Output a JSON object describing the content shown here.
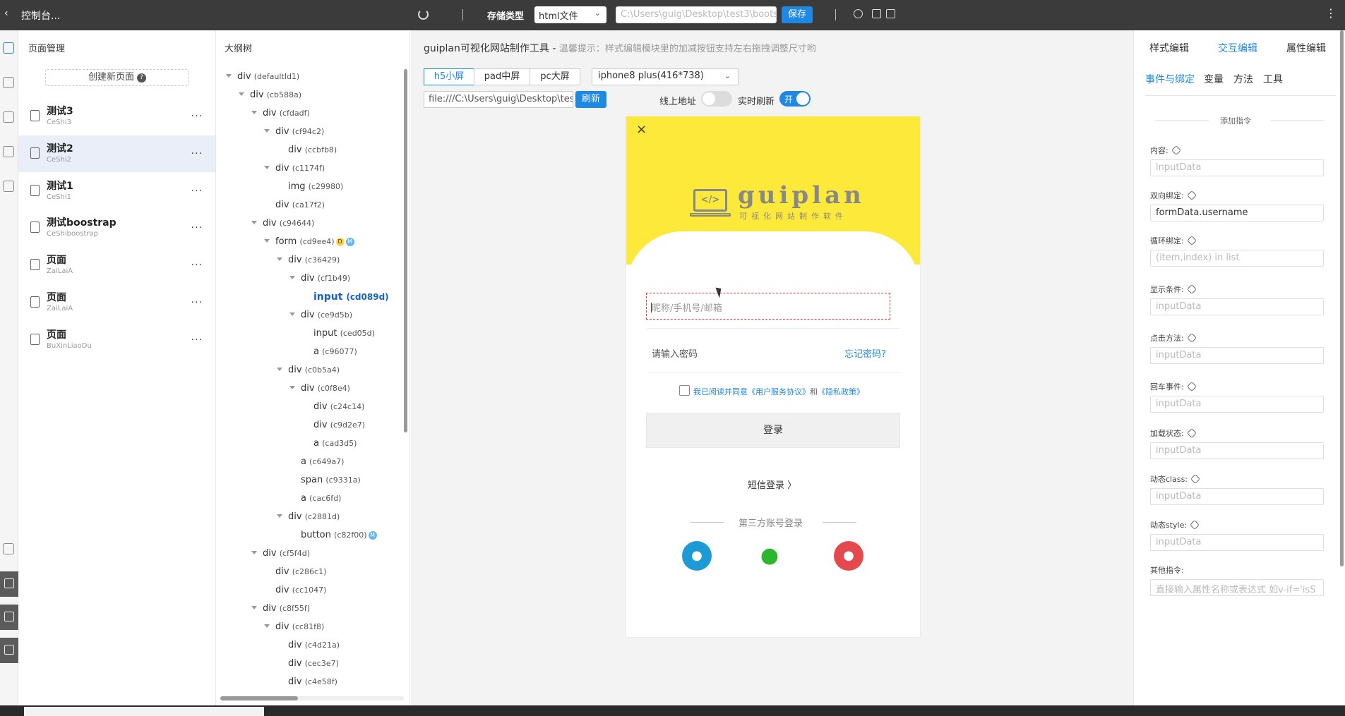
{
  "topbar": {
    "back": "‹",
    "title": "控制台...",
    "store_label": "存储类型",
    "store_value": "html文件",
    "path": "C:\\Users\\guig\\Desktop\\test3\\boots",
    "save": "保存",
    "more": "⋮"
  },
  "pages": {
    "title": "页面管理",
    "create": "创建新页面",
    "items": [
      {
        "name": "测试3",
        "code": "CeShi3"
      },
      {
        "name": "测试2",
        "code": "CeShi2"
      },
      {
        "name": "测试1",
        "code": "CeShi1"
      },
      {
        "name": "测试boostrap",
        "code": "CeShiboostrap"
      },
      {
        "name": "页面",
        "code": "ZaiLaiA"
      },
      {
        "name": "页面",
        "code": "ZaiLaiA"
      },
      {
        "name": "页面",
        "code": "BuXinLiaoDu"
      }
    ],
    "more": "..."
  },
  "tree": {
    "title": "大纲树",
    "nodes": [
      {
        "tag": "div",
        "id": "(defaultId1)"
      },
      {
        "tag": "div",
        "id": "(cb588a)"
      },
      {
        "tag": "div",
        "id": "(cfdadf)"
      },
      {
        "tag": "div",
        "id": "(cf94c2)"
      },
      {
        "tag": "div",
        "id": "(ccbfb8)"
      },
      {
        "tag": "div",
        "id": "(c1174f)"
      },
      {
        "tag": "img",
        "id": "(c29980)"
      },
      {
        "tag": "div",
        "id": "(ca17f2)"
      },
      {
        "tag": "div",
        "id": "(c94644)"
      },
      {
        "tag": "form",
        "id": "(cd9ee4)"
      },
      {
        "tag": "div",
        "id": "(c36429)"
      },
      {
        "tag": "div",
        "id": "(cf1b49)"
      },
      {
        "tag": "input",
        "id": "(cd089d)"
      },
      {
        "tag": "div",
        "id": "(ce9d5b)"
      },
      {
        "tag": "input",
        "id": "(ced05d)"
      },
      {
        "tag": "a",
        "id": "(c96077)"
      },
      {
        "tag": "div",
        "id": "(c0b5a4)"
      },
      {
        "tag": "div",
        "id": "(c0f8e4)"
      },
      {
        "tag": "div",
        "id": "(c24c14)"
      },
      {
        "tag": "div",
        "id": "(c9d2e7)"
      },
      {
        "tag": "a",
        "id": "(cad3d5)"
      },
      {
        "tag": "a",
        "id": "(c649a7)"
      },
      {
        "tag": "span",
        "id": "(c9331a)"
      },
      {
        "tag": "a",
        "id": "(cac6fd)"
      },
      {
        "tag": "div",
        "id": "(c2881d)"
      },
      {
        "tag": "button",
        "id": "(c82f00)"
      },
      {
        "tag": "div",
        "id": "(cf5f4d)"
      },
      {
        "tag": "div",
        "id": "(c286c1)"
      },
      {
        "tag": "div",
        "id": "(cc1047)"
      },
      {
        "tag": "div",
        "id": "(c8f55f)"
      },
      {
        "tag": "div",
        "id": "(cc81f8)"
      },
      {
        "tag": "div",
        "id": "(c4d21a)"
      },
      {
        "tag": "div",
        "id": "(cec3e7)"
      },
      {
        "tag": "div",
        "id": "(c4e58f)"
      }
    ],
    "badge_d": "D",
    "badge_m": "M"
  },
  "main": {
    "tip_title": "guiplan可视化网站制作工具 - ",
    "tip_hint": "温馨提示：样式编辑模块里的加减按钮支持左右拖拽调整尺寸哟",
    "screens": [
      "h5小屏",
      "pad中屏",
      "pc大屏"
    ],
    "device": "iphone8 plus(416*738)",
    "url": "file:///C:\\Users\\guig\\Desktop\\test3\\bootstra",
    "refresh": "刷新",
    "online_label": "线上地址",
    "live_label": "实时刷新",
    "live_on": "开"
  },
  "phone": {
    "close": "×",
    "logo_glyph": "</>",
    "brand": "guiplan",
    "slogan": "可视化网站制作软件",
    "user_placeholder": "昵称/手机号/邮箱",
    "pwd_placeholder": "请输入密码",
    "forgot": "忘记密码?",
    "agree_prefix": "我已阅读并同意《用户服务协议》",
    "agree_and": "和",
    "agree_suffix": "《隐私政策》",
    "login": "登录",
    "sms": "短信登录 〉",
    "third": "第三方账号登录"
  },
  "right": {
    "tabs": [
      "样式编辑",
      "交互编辑",
      "属性编辑"
    ],
    "subtabs": [
      "事件与绑定",
      "变量",
      "方法",
      "工具"
    ],
    "section": "添加指令",
    "fields": [
      {
        "label": "内容:",
        "value": "",
        "placeholder": "inputData"
      },
      {
        "label": "双向绑定:",
        "value": "formData.username",
        "placeholder": ""
      },
      {
        "label": "循环绑定:",
        "value": "",
        "placeholder": "(item,index) in list"
      },
      {
        "label": "显示条件:",
        "value": "",
        "placeholder": "inputData"
      },
      {
        "label": "点击方法:",
        "value": "",
        "placeholder": "inputData"
      },
      {
        "label": "回车事件:",
        "value": "",
        "placeholder": "inputData"
      },
      {
        "label": "加载状态:",
        "value": "",
        "placeholder": "inputData"
      },
      {
        "label": "动态class:",
        "value": "",
        "placeholder": "inputData"
      },
      {
        "label": "动态style:",
        "value": "",
        "placeholder": "inputData"
      },
      {
        "label": "其他指令:",
        "value": "",
        "placeholder": "直接输入属性名称或表达式 如v-if='isS"
      }
    ]
  },
  "colors": {
    "accent": "#1e88e5",
    "topbar": "#3b3b3b",
    "phone_header": "#fde93a",
    "selected_border": "#e53935"
  }
}
